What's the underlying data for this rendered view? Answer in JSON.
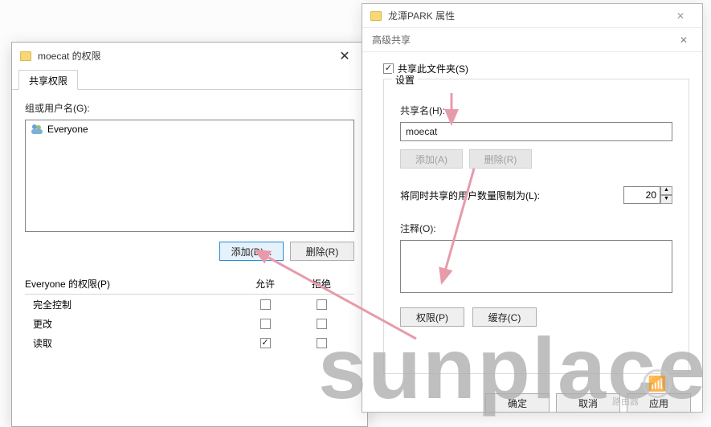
{
  "left": {
    "title": "moecat 的权限",
    "tab_label": "共享权限",
    "group_label": "组或用户名(G):",
    "users": [
      {
        "name": "Everyone"
      }
    ],
    "add_btn": "添加(D)...",
    "remove_btn": "删除(R)",
    "perm_header_prefix": "Everyone 的权限(P)",
    "col_allow": "允许",
    "col_deny": "拒绝",
    "rows": [
      {
        "name": "完全控制",
        "allow": false,
        "deny": false
      },
      {
        "name": "更改",
        "allow": false,
        "deny": false
      },
      {
        "name": "读取",
        "allow": true,
        "deny": false
      }
    ]
  },
  "right": {
    "title": "龙潭PARK 属性",
    "adv_title": "高级共享",
    "share_checkbox_label": "共享此文件夹(S)",
    "share_checked": true,
    "settings_legend": "设置",
    "sharename_label": "共享名(H):",
    "sharename_value": "moecat",
    "add_btn": "添加(A)",
    "remove_btn": "删除(R)",
    "limit_label": "将同时共享的用户数量限制为(L):",
    "limit_value": "20",
    "comment_label": "注释(O):",
    "perm_btn": "权限(P)",
    "cache_btn": "缓存(C)",
    "ok_btn": "确定",
    "cancel_btn": "取消",
    "apply_btn": "应用"
  },
  "watermark": {
    "text": "sunplace",
    "sub": "路由器"
  }
}
